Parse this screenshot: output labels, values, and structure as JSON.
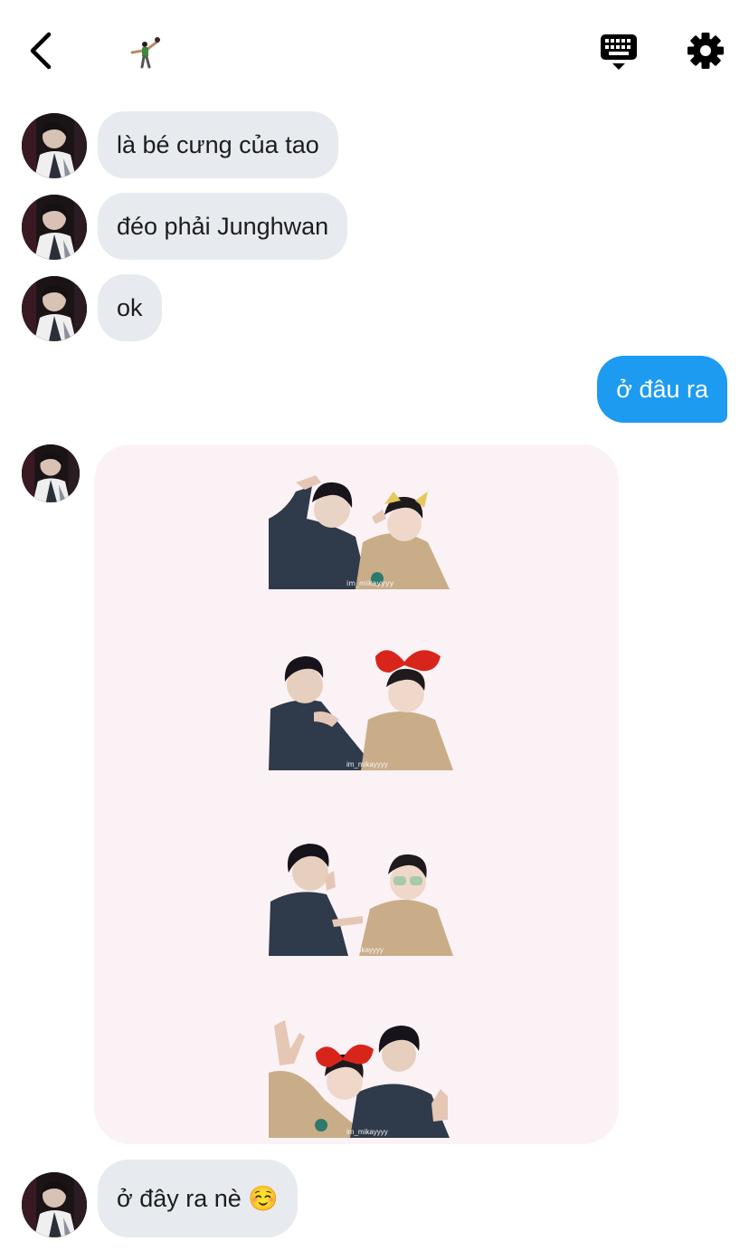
{
  "header": {
    "back_icon": "chevron-left-icon",
    "title_icon": "dancer-figure-icon",
    "keyboard_icon": "keyboard-icon",
    "settings_icon": "gear-icon"
  },
  "messages": [
    {
      "direction": "in",
      "text": "là bé cưng của tao"
    },
    {
      "direction": "in",
      "text": "đéo phải Junghwan"
    },
    {
      "direction": "in",
      "text": "ok"
    },
    {
      "direction": "out",
      "text": "ở đâu ra"
    },
    {
      "direction": "in",
      "type": "sticker-image",
      "stickers": [
        {
          "watermark": "im_mikayyyy"
        },
        {
          "watermark": "im_mikayyyy"
        },
        {
          "watermark": "mikayyyy"
        },
        {
          "watermark": "im_mikayyyy"
        }
      ]
    },
    {
      "direction": "in",
      "text": "ở đây ra nè ☺️"
    }
  ],
  "colors": {
    "incoming_bubble": "#e7ebef",
    "outgoing_bubble": "#1d9bf0",
    "sticker_card_bg": "#fbf2f6",
    "jacket_navy": "#2f3a4a",
    "hoodie_beige": "#c9ad88",
    "bow_red": "#d8251c"
  }
}
